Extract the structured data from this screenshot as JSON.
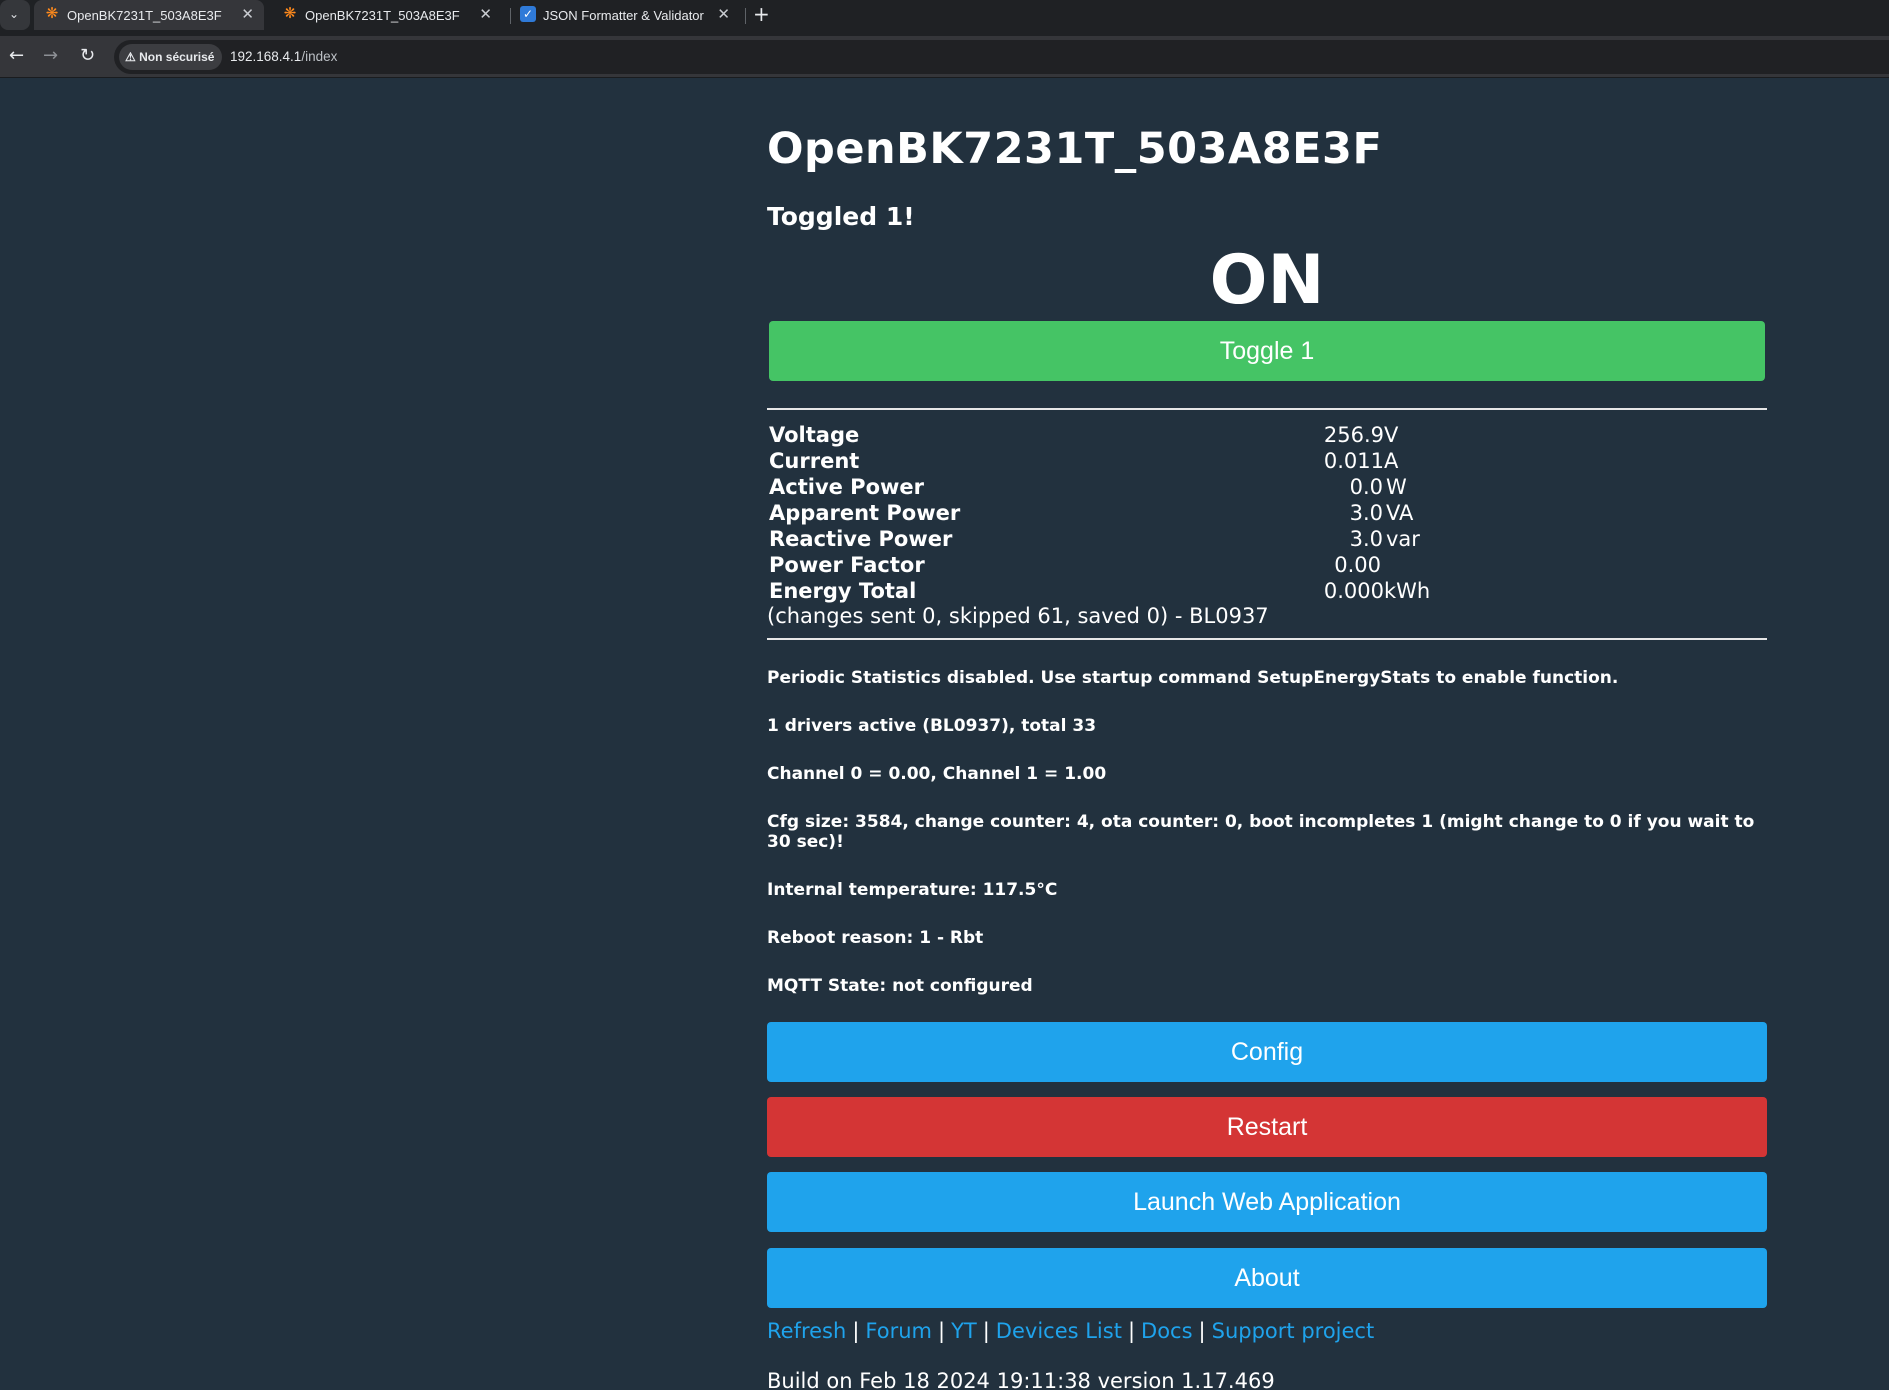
{
  "browser": {
    "tabs": [
      {
        "title": "OpenBK7231T_503A8E3F",
        "favicon": "sun-icon"
      },
      {
        "title": "OpenBK7231T_503A8E3F",
        "favicon": "sun-icon"
      },
      {
        "title": "JSON Formatter & Validator",
        "favicon": "checkbox-icon"
      }
    ],
    "security_label": "Non sécurisé",
    "url_host": "192.168.4.1",
    "url_path": "/index"
  },
  "page": {
    "title": "OpenBK7231T_503A8E3F",
    "toggled_message": "Toggled 1!",
    "state": "ON",
    "toggle_label": "Toggle 1",
    "stats": [
      {
        "label": "Voltage",
        "value": "256.9",
        "unit": "V"
      },
      {
        "label": "Current",
        "value": "0.011",
        "unit": "A"
      },
      {
        "label": "Active Power",
        "value": "0.0",
        "unit": "W"
      },
      {
        "label": "Apparent Power",
        "value": "3.0",
        "unit": "VA"
      },
      {
        "label": "Reactive Power",
        "value": "3.0",
        "unit": "var"
      },
      {
        "label": "Power Factor",
        "value": "0.00",
        "unit": ""
      },
      {
        "label": "Energy Total",
        "value": "0.000",
        "unit": "kWh"
      }
    ],
    "stats_note": "(changes sent 0, skipped 61, saved 0) - BL0937",
    "info": [
      "Periodic Statistics disabled. Use startup command SetupEnergyStats to enable function.",
      "1 drivers active (BL0937), total 33",
      "Channel 0 = 0.00, Channel 1 = 1.00",
      "Cfg size: 3584, change counter: 4, ota counter: 0, boot incompletes 1 (might change to 0 if you wait to 30 sec)!",
      "Internal temperature: 117.5°C",
      "Reboot reason: 1 - Rbt",
      "MQTT State: not configured"
    ],
    "buttons": {
      "config": "Config",
      "restart": "Restart",
      "launch": "Launch Web Application",
      "about": "About"
    },
    "links": [
      "Refresh",
      "Forum",
      "YT",
      "Devices List",
      "Docs",
      "Support project"
    ],
    "link_separator": "|",
    "build": "Build on Feb 18 2024 19:11:38 version 1.17.469"
  },
  "colors": {
    "page_bg": "#22313e",
    "toggle_green": "#45c465",
    "button_blue": "#1fa3ec",
    "restart_red": "#d43535"
  }
}
